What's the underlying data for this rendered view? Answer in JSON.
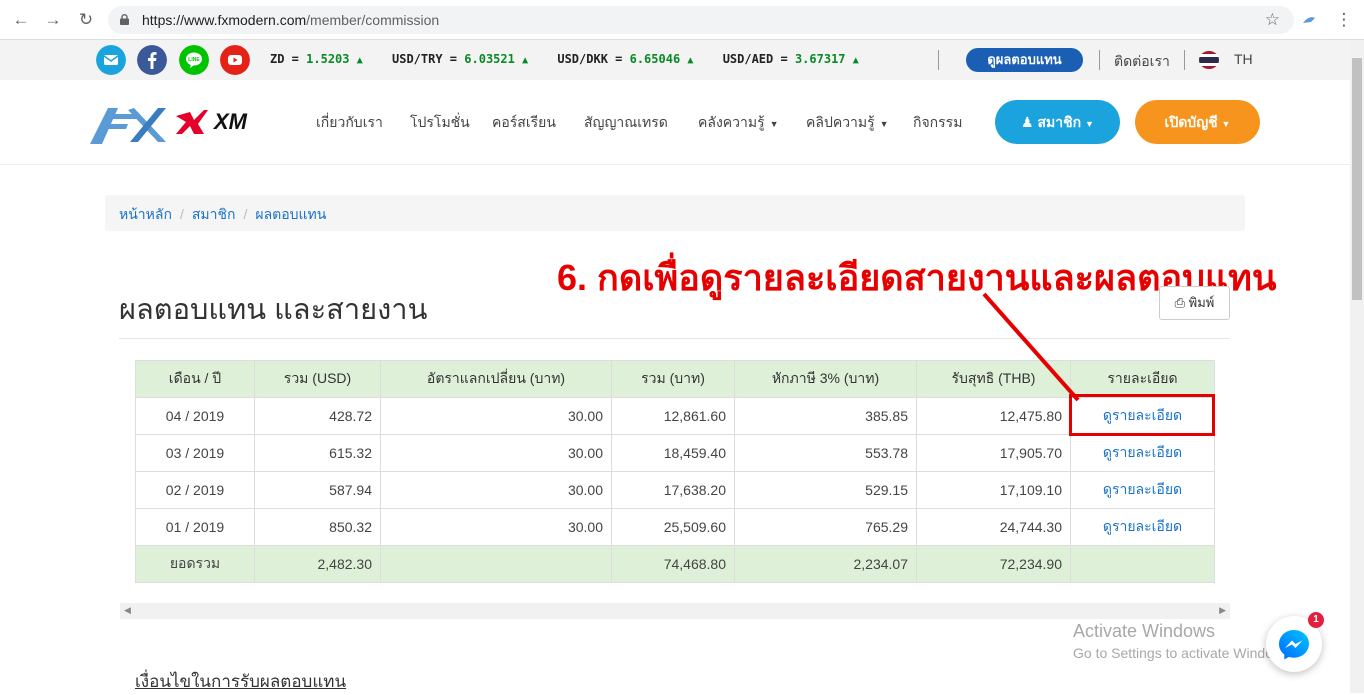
{
  "browser": {
    "url_host": "https://www.fxmodern.com",
    "url_path": "/member/commission"
  },
  "ticker": {
    "items": [
      {
        "pair": "ZD",
        "value": "1.5203"
      },
      {
        "pair": "USD/TRY",
        "value": "6.03521"
      },
      {
        "pair": "USD/DKK",
        "value": "6.65046"
      },
      {
        "pair": "USD/AED",
        "value": "3.67317"
      }
    ],
    "report_button": "ดูผลตอบแทน",
    "contact": "ติดต่อเรา",
    "language": "TH"
  },
  "header": {
    "menu": [
      {
        "label": "เกี่ยวกับเรา",
        "dropdown": false
      },
      {
        "label": "โปรโมชั่น",
        "dropdown": false
      },
      {
        "label": "คอร์สเรียน",
        "dropdown": false
      },
      {
        "label": "สัญญาณเทรด",
        "dropdown": false
      },
      {
        "label": "คลังความรู้",
        "dropdown": true
      },
      {
        "label": "คลิปความรู้",
        "dropdown": true
      },
      {
        "label": "กิจกรรม",
        "dropdown": false
      }
    ],
    "member_button": "สมาชิก",
    "open_account_button": "เปิดบัญชี"
  },
  "breadcrumb": {
    "home": "หน้าหลัก",
    "member": "สมาชิก",
    "current": "ผลตอบแทน"
  },
  "annotation": "6. กดเพื่อดูรายละเอียดสายงานและผลตอบแทน",
  "page_title": "ผลตอบแทน และสายงาน",
  "print_button": "พิมพ์",
  "table": {
    "headers": [
      "เดือน / ปี",
      "รวม (USD)",
      "อัตราแลกเปลี่ยน (บาท)",
      "รวม (บาท)",
      "หักภาษี 3% (บาท)",
      "รับสุทธิ (THB)",
      "รายละเอียด"
    ],
    "rows": [
      {
        "period": "04 / 2019",
        "usd": "428.72",
        "rate": "30.00",
        "thb": "12,861.60",
        "tax": "385.85",
        "net": "12,475.80",
        "detail": "ดูรายละเอียด"
      },
      {
        "period": "03 / 2019",
        "usd": "615.32",
        "rate": "30.00",
        "thb": "18,459.40",
        "tax": "553.78",
        "net": "17,905.70",
        "detail": "ดูรายละเอียด"
      },
      {
        "period": "02 / 2019",
        "usd": "587.94",
        "rate": "30.00",
        "thb": "17,638.20",
        "tax": "529.15",
        "net": "17,109.10",
        "detail": "ดูรายละเอียด"
      },
      {
        "period": "01 / 2019",
        "usd": "850.32",
        "rate": "30.00",
        "thb": "25,509.60",
        "tax": "765.29",
        "net": "24,744.30",
        "detail": "ดูรายละเอียด"
      }
    ],
    "total": {
      "label": "ยอดรวม",
      "usd": "2,482.30",
      "rate": "",
      "thb": "74,468.80",
      "tax": "2,234.07",
      "net": "72,234.90",
      "detail": ""
    }
  },
  "conditions_heading": "เงื่อนไขในการรับผลตอบแทน",
  "watermark": {
    "line1": "Activate Windows",
    "line2": "Go to Settings to activate Windows."
  },
  "messenger_badge": "1",
  "colors": {
    "accent_blue": "#1aa3dd",
    "accent_orange": "#f7941d",
    "annotation_red": "#e60000",
    "table_header_green": "#dff0d8"
  }
}
